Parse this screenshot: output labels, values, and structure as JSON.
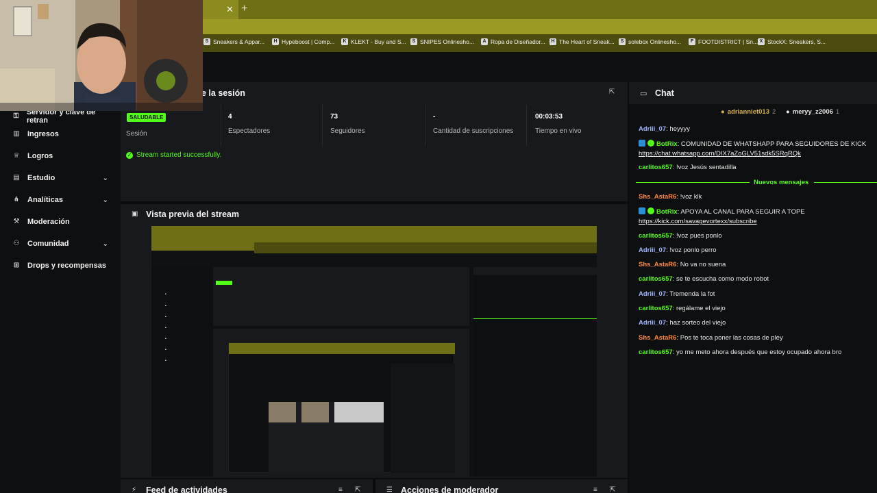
{
  "bookmarks": [
    {
      "label": "Sneakers & Appar...",
      "icon": "S"
    },
    {
      "label": "Hypeboost | Comp...",
      "icon": "H"
    },
    {
      "label": "KLEKT - Buy and S...",
      "icon": "K"
    },
    {
      "label": "SNIPES Onlinesho...",
      "icon": "S"
    },
    {
      "label": "Ropa de Diseñador...",
      "icon": "A"
    },
    {
      "label": "The Heart of Sneak...",
      "icon": "H"
    },
    {
      "label": "solebox Onlinesho...",
      "icon": "S"
    },
    {
      "label": "FOOTDISTRICT | Sn...",
      "icon": "F"
    },
    {
      "label": "StockX: Sneakers, S...",
      "icon": "X"
    }
  ],
  "sidebar": {
    "items": [
      {
        "label": "Servidor y clave de retran",
        "icon": "key-icon",
        "chevron": false
      },
      {
        "label": "Ingresos",
        "icon": "chart-icon",
        "chevron": false
      },
      {
        "label": "Logros",
        "icon": "trophy-icon",
        "chevron": false
      },
      {
        "label": "Estudio",
        "icon": "studio-icon",
        "chevron": true
      },
      {
        "label": "Analíticas",
        "icon": "analytics-icon",
        "chevron": true
      },
      {
        "label": "Moderación",
        "icon": "gavel-icon",
        "chevron": false
      },
      {
        "label": "Comunidad",
        "icon": "community-icon",
        "chevron": true
      },
      {
        "label": "Drops y recompensas",
        "icon": "drops-icon",
        "chevron": false
      }
    ]
  },
  "session": {
    "title": "e la sesión",
    "status_badge": "SALUDABLE",
    "session_label": "Sesión",
    "stats": [
      {
        "value": "4",
        "label": "Espectadores"
      },
      {
        "value": "73",
        "label": "Seguidores"
      },
      {
        "value": "-",
        "label": "Cantidad de suscripciones"
      },
      {
        "value": "00:03:53",
        "label": "Tiempo en vivo"
      }
    ],
    "status_message": "Stream started successfully."
  },
  "preview": {
    "title": "Vista previa del stream"
  },
  "bottom_panels": {
    "activity": "Feed de actividades",
    "moderator": "Acciones de moderador"
  },
  "chat": {
    "title": "Chat",
    "gifters": [
      {
        "name": "adrianniet013",
        "count": "2"
      },
      {
        "name": "meryy_z2006",
        "count": "1"
      }
    ],
    "new_messages_label": "Nuevos mensajes",
    "messages": [
      {
        "user": "Adriii_07",
        "text": "heyyyy",
        "color": "#9fb3ff"
      },
      {
        "user": "BotRix",
        "text": "COMUNIDAD DE WHATSHAPP PARA SEGUIDORES DE KICK",
        "color": "#53fc18",
        "link": "https://chat.whatsapp.com/DIX7aZoGLV51sdk5SRqRQk"
      },
      {
        "user": "carlitos657",
        "text": "!voz Jesús sentadilla",
        "color": "#53fc18"
      },
      {
        "user": "Shs_AstaR6",
        "text": "!voz klk",
        "color": "#ff8a3d"
      },
      {
        "user": "BotRix",
        "text": "APOYA AL CANAL PARA SEGUIR A TOPE",
        "color": "#53fc18",
        "link": "https://kick.com/savagevortexx/subscribe"
      },
      {
        "user": "carlitos657",
        "text": "!voz pues ponlo",
        "color": "#53fc18"
      },
      {
        "user": "Adriii_07",
        "text": "!voz ponlo perro",
        "color": "#9fb3ff"
      },
      {
        "user": "Shs_AstaR6",
        "text": "No va no suena",
        "color": "#ff8a3d"
      },
      {
        "user": "carlitos657",
        "text": "se te escucha como modo robot",
        "color": "#53fc18"
      },
      {
        "user": "Adriii_07",
        "text": "Tremenda la fot",
        "color": "#9fb3ff"
      },
      {
        "user": "carlitos657",
        "text": "regálame el viejo",
        "color": "#53fc18"
      },
      {
        "user": "Adriii_07",
        "text": "haz sorteo del viejo",
        "color": "#9fb3ff"
      },
      {
        "user": "Shs_AstaR6",
        "text": "Pos te toca poner las cosas de pley",
        "color": "#ff8a3d"
      },
      {
        "user": "carlitos657",
        "text": "yo me meto ahora después que estoy ocupado ahora bro",
        "color": "#53fc18"
      }
    ]
  },
  "colors": {
    "accent": "#53fc18",
    "browser": "#6f6f15",
    "panel": "#18191c",
    "bg": "#0e0f11"
  }
}
